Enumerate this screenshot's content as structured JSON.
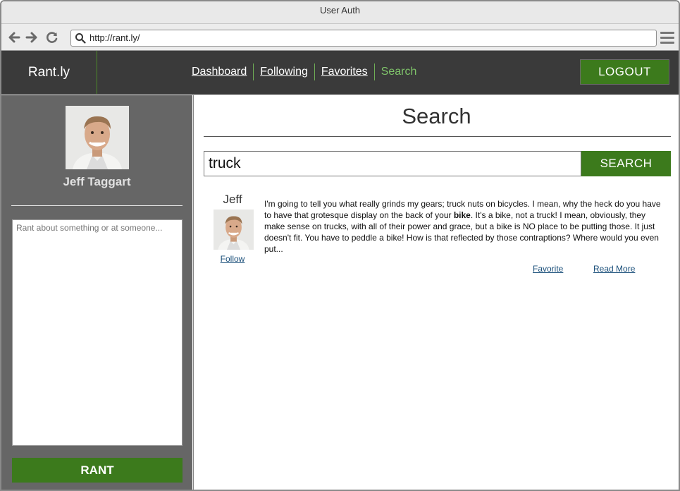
{
  "window": {
    "title": "User Auth",
    "url": "http://rant.ly/"
  },
  "appbar": {
    "brand": "Rant.ly",
    "nav": [
      {
        "label": "Dashboard",
        "active": false
      },
      {
        "label": "Following",
        "active": false
      },
      {
        "label": "Favorites",
        "active": false
      },
      {
        "label": "Search",
        "active": true
      }
    ],
    "logout_label": "LOGOUT"
  },
  "sidebar": {
    "user_name": "Jeff Taggart",
    "rant_placeholder": "Rant about something or at someone...",
    "rant_button": "RANT"
  },
  "main": {
    "title": "Search",
    "search_value": "truck",
    "search_button": "SEARCH",
    "results": [
      {
        "author": "Jeff",
        "follow_label": "Follow",
        "text_before_bold": "I'm going to tell you what really grinds my gears; truck nuts on bicycles. I mean, why the heck do you have to have that grotesque display on the back of your ",
        "text_bold": "bike",
        "text_after_bold": ". It's a bike, not a truck! I mean, obviously, they make sense on trucks, with all of their power and grace, but a bike is NO place to be putting those. It just doesn't fit. You have to peddle a bike! How is that reflected by those contraptions? Where would you even put...",
        "favorite_label": "Favorite",
        "read_more_label": "Read More"
      }
    ]
  },
  "colors": {
    "appbar_bg": "#3a3a3a",
    "sidebar_bg": "#666666",
    "accent_green": "#3c7a1c",
    "active_nav": "#7fc46a",
    "link_blue": "#1a4f7a"
  },
  "icons": [
    "back-arrow-icon",
    "forward-arrow-icon",
    "reload-icon",
    "search-icon",
    "hamburger-menu-icon"
  ]
}
